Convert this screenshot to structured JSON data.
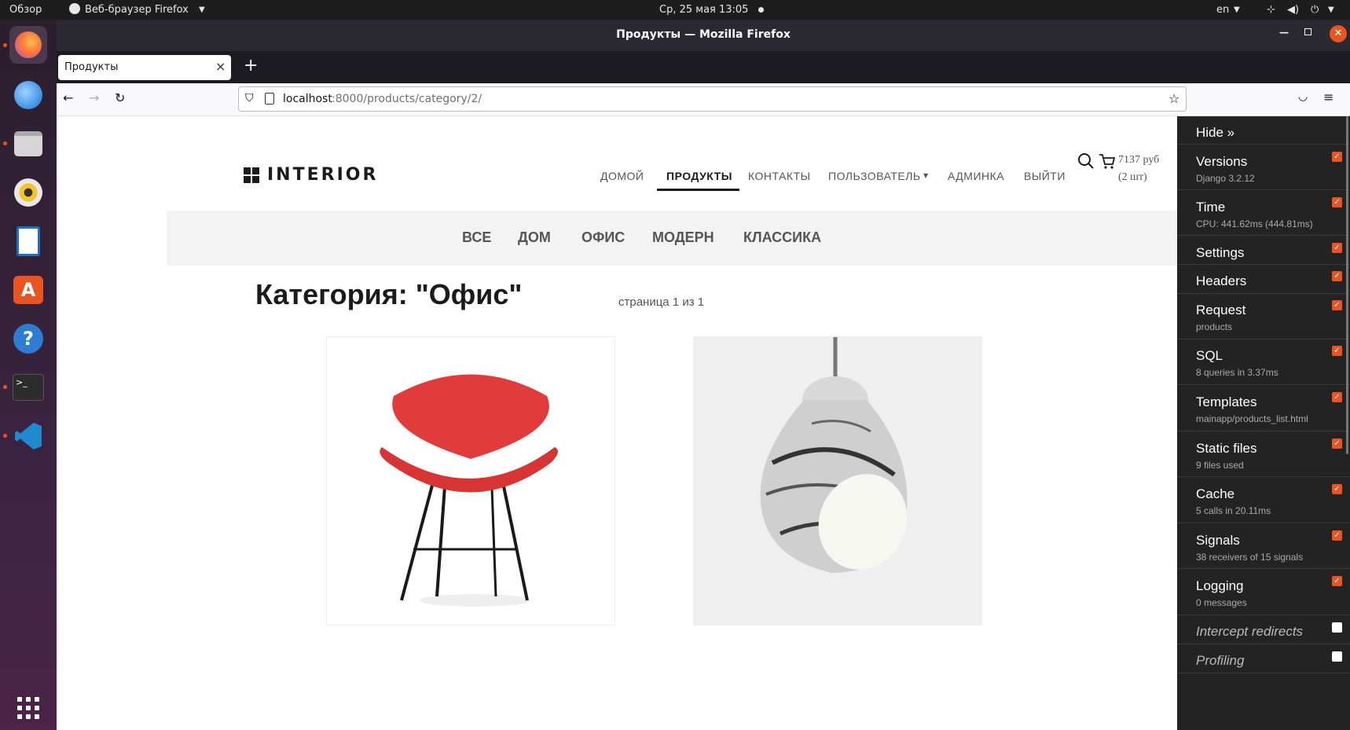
{
  "system": {
    "overview": "Обзор",
    "app_menu": "Веб-браузер Firefox",
    "clock": "Ср, 25 мая  13:05",
    "lang": "en"
  },
  "window": {
    "title": "Продукты — Mozilla Firefox"
  },
  "tab": {
    "title": "Продукты",
    "close": "×",
    "new_tab": "+"
  },
  "url": {
    "host": "localhost",
    "path": ":8000/products/category/2/"
  },
  "site": {
    "logo": "INTERIOR",
    "nav": [
      "ДОМОЙ",
      "ПРОДУКТЫ",
      "КОНТАКТЫ",
      "ПОЛЬЗОВАТЕЛЬ",
      "АДМИНКА",
      "ВЫЙТИ"
    ],
    "cart_price": "7137 руб",
    "cart_count": "(2 шт)",
    "categories": [
      "ВСЕ",
      "ДОМ",
      "ОФИС",
      "МОДЕРН",
      "КЛАССИКА"
    ],
    "heading": "Категория: \"Офис\"",
    "page_info": "страница 1 из 1"
  },
  "debug_toolbar": {
    "hide": "Hide »",
    "panels": [
      {
        "title": "Versions",
        "sub": "Django 3.2.12",
        "checked": true
      },
      {
        "title": "Time",
        "sub": "CPU: 441.62ms (444.81ms)",
        "checked": true
      },
      {
        "title": "Settings",
        "sub": "",
        "checked": true
      },
      {
        "title": "Headers",
        "sub": "",
        "checked": true
      },
      {
        "title": "Request",
        "sub": "products",
        "checked": true
      },
      {
        "title": "SQL",
        "sub": "8 queries in 3.37ms",
        "checked": true
      },
      {
        "title": "Templates",
        "sub": "mainapp/products_list.html",
        "checked": true
      },
      {
        "title": "Static files",
        "sub": "9 files used",
        "checked": true
      },
      {
        "title": "Cache",
        "sub": "5 calls in 20.11ms",
        "checked": true
      },
      {
        "title": "Signals",
        "sub": "38 receivers of 15 signals",
        "checked": true
      },
      {
        "title": "Logging",
        "sub": "0 messages",
        "checked": true
      },
      {
        "title": "Intercept redirects",
        "sub": "",
        "checked": false
      },
      {
        "title": "Profiling",
        "sub": "",
        "checked": false
      }
    ]
  },
  "colors": {
    "accent": "#e95420",
    "toolbar_bg": "#232323",
    "catbar_bg": "#f3f3f3"
  }
}
